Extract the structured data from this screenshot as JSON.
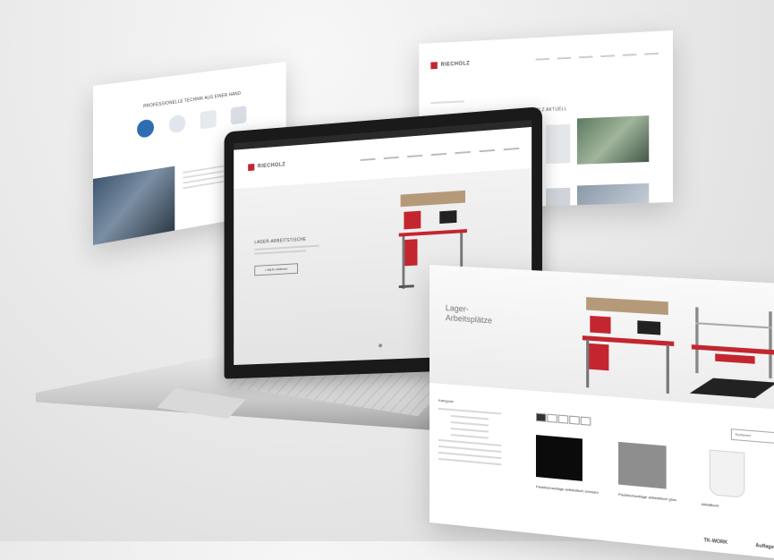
{
  "panel_top_left": {
    "heading": "PROFESSIONELLE TECHNIK AUS EINER HAND",
    "icons": [
      "chat-bubble-icon",
      "hand-icon",
      "document-icon",
      "tablet-icon"
    ]
  },
  "panel_top_right": {
    "brand": "RIECHOLZ",
    "title": "RIECHOLZ AKTUELL"
  },
  "laptop_screen": {
    "brand": "RIECHOLZ",
    "headline": "LAGER-ARBEITSTISCHE",
    "cta": "> Mehr erfahren"
  },
  "panel_front": {
    "hero_title_line1": "Lager-",
    "hero_title_line2": "Arbeitsplätze",
    "sidebar_heading": "Kategorie",
    "sort_label": "Sortieren",
    "products": [
      {
        "caption": "Packtischauflage antistatisch schwarz"
      },
      {
        "caption": "Packtischauflage antistatisch grau"
      },
      {
        "caption": "Abfallkorb"
      }
    ],
    "footer_logos": [
      "TK-WORK",
      "Auflage"
    ]
  }
}
